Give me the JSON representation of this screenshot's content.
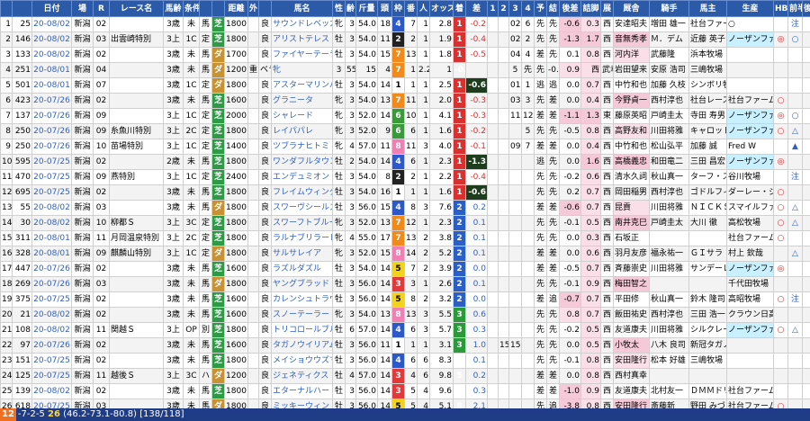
{
  "headers": [
    "",
    "",
    "日付",
    "場",
    "R",
    "レース名",
    "馬齢",
    "条件",
    "",
    "",
    "距離",
    "外",
    "",
    "馬名",
    "性",
    "齢",
    "斤量",
    "頭",
    "枠",
    "番",
    "人",
    "オッズ",
    "着",
    "差",
    "1",
    "2",
    "3",
    "4",
    "予",
    "結",
    "後差",
    "詰脚",
    "展",
    "厩舎",
    "騎手",
    "馬主",
    "生産",
    "HB",
    "前半",
    "後半"
  ],
  "rows": [
    [
      "1",
      "25",
      "20-08/02",
      "新潟",
      "02",
      "",
      "3歳",
      "未",
      "馬",
      "芝",
      "1800",
      "",
      "良",
      "サウンドレベッカ",
      "牝",
      "3",
      "54.0",
      "18",
      "4",
      "7",
      "1",
      "2.8",
      "1",
      "-0.2",
      "",
      "",
      "02",
      "6",
      "先",
      "先",
      "-0.6",
      "0.3",
      "西",
      "安達昭夫",
      "増田 雄一",
      "社台ファーム",
      "○",
      "",
      "注"
    ],
    [
      "2",
      "146",
      "20-08/02",
      "新潟",
      "03",
      "出雲崎特別",
      "3上",
      "1C",
      "定",
      "芝",
      "1800",
      "",
      "良",
      "アリストテレス",
      "牡",
      "3",
      "54.0",
      "11",
      "2",
      "2",
      "1",
      "1.9",
      "1",
      "-0.4",
      "",
      "",
      "02",
      "2",
      "先",
      "先",
      "-1.3",
      "1.7",
      "西",
      "音無秀孝",
      "Ｍ．デム",
      "近藤 英子",
      "ノーザンファ",
      "◎",
      "○"
    ],
    [
      "3",
      "133",
      "20-08/02",
      "新潟",
      "02",
      "",
      "3歳",
      "未",
      "馬",
      "ダ",
      "1700",
      "",
      "良",
      "ファイヤーテーラー",
      "牡",
      "3",
      "54.0",
      "15",
      "7",
      "13",
      "1",
      "1.8",
      "1",
      "-0.5",
      "",
      "",
      "04",
      "4",
      "差",
      "先",
      "0.1",
      "0.8",
      "西",
      "河内洋",
      "武藤隆",
      "浜本牧場",
      "",
      ""
    ],
    [
      "4",
      "251",
      "20-08/01",
      "新潟",
      "04",
      "",
      "3歳",
      "未",
      "馬",
      "ダ",
      "1200",
      "重",
      "ベラール",
      "牝",
      "3",
      "55.0",
      "15",
      "4",
      "7",
      "1",
      "2.2",
      "1",
      "-0.5",
      "",
      "",
      "",
      "5",
      "先",
      "先",
      "-0.4",
      "0.9",
      "西",
      "武幸四郎",
      "岩田望来",
      "安原 浩司",
      "三嶋牧場",
      "",
      ""
    ],
    [
      "5",
      "501",
      "20-08/01",
      "新潟",
      "07",
      "",
      "3歳",
      "1C",
      "定",
      "ダ",
      "1800",
      "",
      "良",
      "アスターマリンバ",
      "牡",
      "3",
      "54.0",
      "14",
      "1",
      "1",
      "1",
      "2.5",
      "1",
      "-0.6",
      "",
      "",
      "01",
      "1",
      "逃",
      "逃",
      "0.0",
      "0.7",
      "西",
      "中竹和也",
      "加藤 久枝",
      "シンボリ牧場",
      "",
      ""
    ],
    [
      "6",
      "423",
      "20-07/26",
      "新潟",
      "02",
      "",
      "3歳",
      "未",
      "馬",
      "芝",
      "1600",
      "",
      "良",
      "グラニータ",
      "牝",
      "3",
      "54.0",
      "13",
      "7",
      "11",
      "1",
      "2.0",
      "1",
      "-0.3",
      "",
      "",
      "03",
      "3",
      "先",
      "差",
      "0.0",
      "0.4",
      "西",
      "今野貞一",
      "西村淳也",
      "社台レースホ",
      "社台ファーム",
      "○",
      ""
    ],
    [
      "7",
      "137",
      "20-07/26",
      "新潟",
      "09",
      "",
      "3上",
      "1C",
      "定",
      "芝",
      "2000",
      "",
      "良",
      "シャレード",
      "牝",
      "3",
      "52.0",
      "14",
      "6",
      "10",
      "1",
      "4.1",
      "1",
      "-0.3",
      "",
      "",
      "11",
      "12",
      "差",
      "差",
      "-1.1",
      "1.3",
      "東",
      "藤原英昭",
      "戸崎圭太",
      "寺田 寿男",
      "ノーザンファ",
      "◎",
      "○"
    ],
    [
      "8",
      "250",
      "20-07/26",
      "新潟",
      "09",
      "糸魚川特別",
      "3上",
      "2C",
      "定",
      "芝",
      "1800",
      "",
      "良",
      "レイパパレ",
      "牝",
      "3",
      "52.0",
      "9",
      "6",
      "6",
      "1",
      "1.6",
      "1",
      "-0.2",
      "",
      "",
      "",
      "5",
      "先",
      "先",
      "-0.5",
      "0.8",
      "西",
      "高野友和",
      "川田将雅",
      "キャロットフ",
      "ノーザンファ",
      "○",
      "△"
    ],
    [
      "9",
      "250",
      "20-07/26",
      "新潟",
      "10",
      "苗場特別",
      "3上",
      "1C",
      "定",
      "芝",
      "1400",
      "",
      "良",
      "ツブラナヒトミ",
      "牝",
      "4",
      "57.0",
      "11",
      "8",
      "11",
      "3",
      "4.0",
      "1",
      "-0.1",
      "",
      "",
      "09",
      "7",
      "差",
      "差",
      "0.0",
      "0.4",
      "西",
      "中竹和也",
      "松山弘平",
      "加藤 誠",
      "Fred W",
      "",
      "▲"
    ],
    [
      "10",
      "595",
      "20-07/25",
      "新潟",
      "02",
      "",
      "2歳",
      "未",
      "馬",
      "芝",
      "1800",
      "",
      "良",
      "ワンダフルタウン",
      "牡",
      "2",
      "54.0",
      "14",
      "4",
      "6",
      "1",
      "2.3",
      "1",
      "-1.3",
      "",
      "",
      "",
      "",
      "逃",
      "先",
      "0.0",
      "1.6",
      "西",
      "高橋義忠",
      "和田竜二",
      "三田 昌宏",
      "ノーザンファ",
      "◎",
      ""
    ],
    [
      "11",
      "470",
      "20-07/25",
      "新潟",
      "09",
      "燕特別",
      "3上",
      "1C",
      "定",
      "芝",
      "2400",
      "",
      "良",
      "エンデュミオン",
      "牡",
      "3",
      "54.0",
      "8",
      "2",
      "2",
      "1",
      "2.2",
      "1",
      "-0.4",
      "",
      "",
      "",
      "",
      "先",
      "先",
      "-0.2",
      "0.6",
      "西",
      "清水久詞",
      "秋山真一",
      "ターフ・スポ",
      "谷川牧場",
      "",
      "注"
    ],
    [
      "12",
      "695",
      "20-07/25",
      "新潟",
      "02",
      "",
      "3歳",
      "未",
      "馬",
      "芝",
      "1800",
      "",
      "良",
      "フレイムウィングス",
      "牡",
      "3",
      "54.0",
      "16",
      "1",
      "1",
      "1",
      "1.6",
      "1",
      "-0.6",
      "",
      "",
      "",
      "",
      "先",
      "先",
      "0.2",
      "0.7",
      "西",
      "岡田稲男",
      "西村淳也",
      "ゴドルフィン",
      "ダーレー・ジ",
      "○",
      ""
    ],
    [
      "13",
      "55",
      "20-08/02",
      "新潟",
      "03",
      "",
      "3歳",
      "未",
      "馬",
      "ダ",
      "1800",
      "",
      "良",
      "スワーヴシールズ",
      "牡",
      "3",
      "56.0",
      "15",
      "4",
      "8",
      "3",
      "7.6",
      "2",
      "0.2",
      "",
      "",
      "",
      "",
      "差",
      "差",
      "-0.6",
      "0.7",
      "西",
      "昆貢",
      "川田将雅",
      "ＮＩＣＫＳ",
      "スマイルファ",
      "○",
      "△"
    ],
    [
      "14",
      "30",
      "20-08/02",
      "新潟",
      "10",
      "柳都Ｓ",
      "3上",
      "3C",
      "定",
      "芝",
      "1800",
      "",
      "良",
      "スワーフトブルーレ",
      "牝",
      "3",
      "52.0",
      "13",
      "7",
      "12",
      "1",
      "2.3",
      "2",
      "0.1",
      "",
      "",
      "",
      "",
      "先",
      "先",
      "-0.1",
      "0.5",
      "西",
      "南井克巳",
      "戸崎圭太",
      "大川 徹",
      "高松牧場",
      "○",
      "△"
    ],
    [
      "15",
      "311",
      "20-08/01",
      "新潟",
      "11",
      "月岡温泉特別",
      "3上",
      "2C",
      "定",
      "芝",
      "1800",
      "",
      "良",
      "ラルナブリラーレ",
      "牝",
      "4",
      "55.0",
      "17",
      "7",
      "13",
      "2",
      "3.8",
      "2",
      "0.1",
      "",
      "",
      "",
      "",
      "先",
      "先",
      "0.0",
      "0.3",
      "西",
      "石坂正",
      "",
      "",
      "社台ファーム",
      "○",
      ""
    ],
    [
      "16",
      "328",
      "20-08/01",
      "新潟",
      "09",
      "麒麟山特別",
      "3上",
      "1C",
      "定",
      "ダ",
      "1800",
      "",
      "良",
      "サルサレイア",
      "牝",
      "3",
      "52.0",
      "15",
      "8",
      "14",
      "2",
      "5.2",
      "2",
      "0.1",
      "",
      "",
      "",
      "",
      "差",
      "差",
      "0.0",
      "0.6",
      "西",
      "羽月友彦",
      "福永祐一",
      "ＧＩサラ",
      "村上 欽哉",
      "",
      "△"
    ],
    [
      "17",
      "447",
      "20-07/26",
      "新潟",
      "02",
      "",
      "3歳",
      "未",
      "馬",
      "芝",
      "1600",
      "",
      "良",
      "ラズルダズル",
      "牡",
      "3",
      "54.0",
      "14",
      "5",
      "7",
      "2",
      "3.9",
      "2",
      "0.0",
      "",
      "",
      "",
      "",
      "差",
      "差",
      "-0.5",
      "0.7",
      "西",
      "斉藤崇史",
      "川田将雅",
      "サンデーレー",
      "ノーザンファ",
      "◎",
      ""
    ],
    [
      "18",
      "269",
      "20-07/26",
      "新潟",
      "03",
      "",
      "3歳",
      "未",
      "馬",
      "ダ",
      "1800",
      "",
      "良",
      "ヤングブラッド",
      "牡",
      "3",
      "56.0",
      "14",
      "3",
      "3",
      "1",
      "2.6",
      "2",
      "0.1",
      "",
      "",
      "",
      "",
      "先",
      "先",
      "-0.1",
      "0.9",
      "西",
      "梅田智之",
      "",
      "",
      "千代田牧場",
      "",
      ""
    ],
    [
      "19",
      "375",
      "20-07/25",
      "新潟",
      "02",
      "",
      "3歳",
      "未",
      "馬",
      "芝",
      "1600",
      "",
      "良",
      "カレンシュトラウス",
      "牡",
      "3",
      "56.0",
      "14",
      "5",
      "8",
      "2",
      "3.2",
      "2",
      "0.0",
      "",
      "",
      "",
      "",
      "差",
      "追",
      "-0.7",
      "0.7",
      "西",
      "平田修",
      "秋山真一",
      "鈴木 隆司",
      "高昭牧場",
      "○",
      "注"
    ],
    [
      "20",
      "21",
      "20-08/02",
      "新潟",
      "02",
      "",
      "3歳",
      "未",
      "馬",
      "芝",
      "1600",
      "",
      "良",
      "スノーテーラー",
      "牝",
      "3",
      "54.0",
      "13",
      "8",
      "13",
      "3",
      "5.5",
      "3",
      "0.6",
      "",
      "",
      "",
      "",
      "先",
      "先",
      "0.8",
      "0.7",
      "西",
      "飯田祐史",
      "西村淳也",
      "三田 浩一",
      "クラウン日高",
      "",
      ""
    ],
    [
      "21",
      "108",
      "20-08/02",
      "新潟",
      "11",
      "関越Ｓ",
      "3上",
      "OP",
      "別",
      "芝",
      "1800",
      "",
      "良",
      "トリコロールブルー",
      "牡",
      "6",
      "57.0",
      "14",
      "4",
      "6",
      "3",
      "5.7",
      "3",
      "0.3",
      "",
      "",
      "",
      "",
      "先",
      "先",
      "-0.2",
      "0.5",
      "西",
      "友道康夫",
      "川田将雅",
      "シルクレーシ",
      "ノーザンファ",
      "○",
      "△"
    ],
    [
      "22",
      "97",
      "20-07/26",
      "新潟",
      "02",
      "",
      "3歳",
      "未",
      "馬",
      "芝",
      "1600",
      "",
      "良",
      "タガノウイリアム",
      "牡",
      "3",
      "56.0",
      "11",
      "1",
      "1",
      "1",
      "3.1",
      "3",
      "1.0",
      "",
      "15",
      "15",
      "",
      "先",
      "先",
      "0.0",
      "0.5",
      "西",
      "小牧太",
      "八木 良司",
      "新冠タガノフ",
      "",
      ""
    ],
    [
      "23",
      "151",
      "20-07/25",
      "新潟",
      "02",
      "",
      "3歳",
      "未",
      "馬",
      "芝",
      "1800",
      "",
      "良",
      "メイショウウズマサ",
      "牡",
      "3",
      "56.0",
      "14",
      "4",
      "6",
      "6",
      "8.3",
      "4",
      "0.1",
      "",
      "",
      "",
      "",
      "先",
      "先",
      "-0.1",
      "0.8",
      "西",
      "安田隆行",
      "松本 好雄",
      "三嶋牧場",
      "",
      "",
      ""
    ],
    [
      "24",
      "125",
      "20-07/25",
      "新潟",
      "11",
      "越後Ｓ",
      "3上",
      "3C",
      "ハ",
      "ダ",
      "1200",
      "",
      "良",
      "ジェネティクス",
      "牡",
      "4",
      "57.0",
      "14",
      "3",
      "4",
      "6",
      "9.8",
      "5",
      "0.2",
      "",
      "",
      "",
      "",
      "差",
      "差",
      "0.0",
      "0.8",
      "西",
      "西村真幸",
      "",
      "",
      "",
      "",
      ""
    ],
    [
      "25",
      "139",
      "20-08/02",
      "新潟",
      "02",
      "",
      "3歳",
      "未",
      "馬",
      "芝",
      "1800",
      "",
      "良",
      "エターナルハート",
      "牡",
      "3",
      "56.0",
      "14",
      "3",
      "5",
      "4",
      "9.6",
      "8",
      "0.3",
      "",
      "",
      "",
      "",
      "差",
      "差",
      "-1.0",
      "0.9",
      "西",
      "友道康夫",
      "北村友一",
      "ＤＭＭドリー",
      "社台ファーム",
      "",
      ""
    ],
    [
      "26",
      "618",
      "20-07/25",
      "新潟",
      "03",
      "",
      "3歳",
      "未",
      "馬",
      "ダ",
      "1800",
      "",
      "良",
      "ミッキーウィン",
      "牡",
      "3",
      "56.0",
      "14",
      "5",
      "5",
      "4",
      "5.1",
      "8",
      "2.1",
      "",
      "",
      "",
      "",
      "先",
      "追",
      "-3.8",
      "0.8",
      "西",
      "安田隆行",
      "斎藤新",
      "野田 みづき",
      "社台ファーム",
      "○",
      ""
    ]
  ],
  "status": {
    "counter": "12",
    "prefix": "-7-2-5",
    "bold_value": "26",
    "detail": "(46.2-73.1-80.8) [138/118]"
  }
}
